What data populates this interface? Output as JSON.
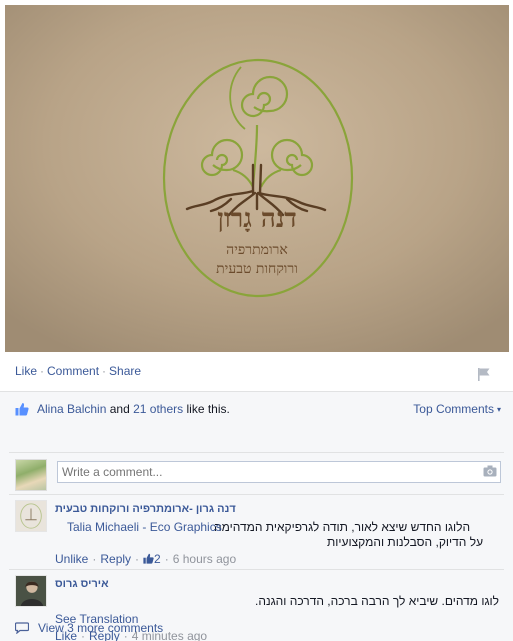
{
  "post": {
    "image": {
      "logo_name": "דנה גָרון",
      "logo_tagline_1": "ארומתרפיה",
      "logo_tagline_2": "ורוקחות טבעית",
      "icon": "tree-of-life-spiral-logo"
    },
    "actions": {
      "like_label": "Like",
      "comment_label": "Comment",
      "share_label": "Share",
      "separator": "·"
    }
  },
  "likes": {
    "first_name": "Alina Balchin",
    "connector": "and",
    "others": "21 others",
    "suffix": "like this.",
    "sort_label": "Top Comments",
    "sort_caret": "▾"
  },
  "composer": {
    "placeholder": "Write a comment..."
  },
  "comments": [
    {
      "author": "דנה גרון -ארומתרפיה ורוקחות טבעית",
      "line1": "הלוגו החדש שיצא לאור, תודה לגרפיקאית המדהימה",
      "tagged": "Talia Michaeli - Eco Graphics",
      "line2": "על הדיוק, הסבלנות והמקצועיות",
      "unlike_label": "Unlike",
      "reply_label": "Reply",
      "like_count": "2",
      "time": "6 hours ago"
    },
    {
      "author": "איריס גרוס",
      "line1": "לוגו מדהים. שיביא לך הרבה ברכה, הדרכה והגנה.",
      "see_translation": "See Translation",
      "like_label": "Like",
      "reply_label": "Reply",
      "time": "4 minutes ago"
    }
  ],
  "view_more": "View 3 more comments",
  "colors": {
    "link": "#3b5998",
    "muted": "#90949c",
    "feedback_bg": "#f6f7f9",
    "logo_green": "#8aa43a",
    "logo_brown": "#5a3e24"
  }
}
